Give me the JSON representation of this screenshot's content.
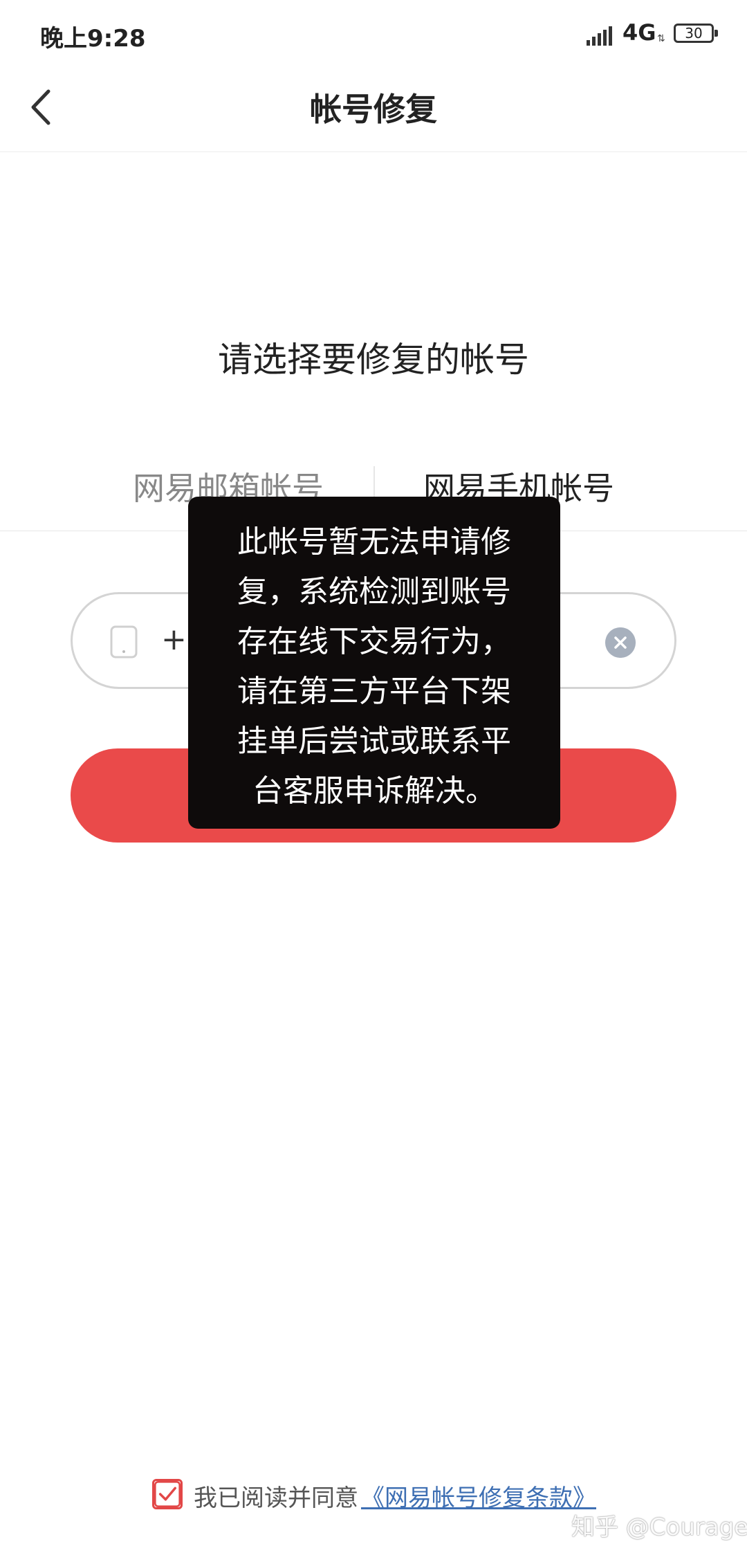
{
  "status_bar": {
    "time": "晚上9:28",
    "network": "4G",
    "battery": "30"
  },
  "nav": {
    "title": "帐号修复"
  },
  "section": {
    "title": "请选择要修复的帐号"
  },
  "tabs": [
    {
      "label": "网易邮箱帐号"
    },
    {
      "label": "网易手机帐号"
    }
  ],
  "phone_input": {
    "country_code": "+86"
  },
  "toast": {
    "message": "此帐号暂无法申请修\n复，系统检测到账号\n存在线下交易行为，\n请在第三方平台下架\n挂单后尝试或联系平\n台客服申诉解决。"
  },
  "agreement": {
    "text": "我已阅读并同意",
    "link": "《网易帐号修复条款》"
  },
  "watermark": "知乎 @Courage",
  "colors": {
    "accent": "#ea4a4a",
    "link": "#3e6fb3"
  }
}
